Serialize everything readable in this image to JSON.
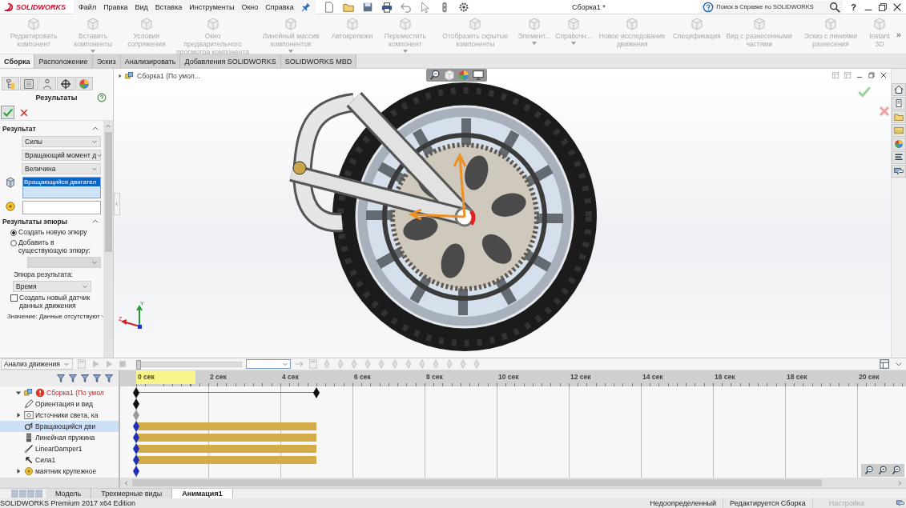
{
  "titlebar": {
    "logo": "SOLIDWORKS",
    "menu": [
      "Файл",
      "Правка",
      "Вид",
      "Вставка",
      "Инструменты",
      "Окно",
      "Справка"
    ],
    "title": "Сборка1 *",
    "search": {
      "placeholder": "Поиск в Справке по SOLIDWORKS"
    },
    "help": "?"
  },
  "ribbon": [
    {
      "label": "Редактировать компонент",
      "disabled": true,
      "has_menu": false
    },
    {
      "label": "Вставить компоненты",
      "disabled": true,
      "has_menu": true
    },
    {
      "label": "Условия сопряжения",
      "disabled": true,
      "has_menu": false
    },
    {
      "label": "Окно предварительного просмотра компонента",
      "disabled": true,
      "has_menu": false
    },
    {
      "label": "Линейный массив компонентов",
      "disabled": true,
      "has_menu": true
    },
    {
      "label": "Автокрепежи",
      "disabled": true,
      "has_menu": false
    },
    {
      "label": "Переместить компонент",
      "disabled": true,
      "has_menu": true
    },
    {
      "label": "Отобразить скрытые компоненты",
      "disabled": true,
      "has_menu": false
    },
    {
      "label": "Элемент...",
      "disabled": true,
      "has_menu": true
    },
    {
      "label": "Справочн...",
      "disabled": true,
      "has_menu": true
    },
    {
      "label": "Новое исследование движения",
      "disabled": true,
      "has_menu": false
    },
    {
      "label": "Спецификация",
      "disabled": true,
      "has_menu": false
    },
    {
      "label": "Вид с разнесенными частями",
      "disabled": true,
      "has_menu": false
    },
    {
      "label": "Эскиз с линиями разнесения",
      "disabled": true,
      "has_menu": false
    },
    {
      "label": "Instant 3D",
      "disabled": true,
      "has_menu": false
    }
  ],
  "ribbon_more": "»",
  "tabs": [
    {
      "label": "Сборка",
      "selected": true
    },
    {
      "label": "Расположение",
      "selected": false
    },
    {
      "label": "Эскиз",
      "selected": false
    },
    {
      "label": "Анализировать",
      "selected": false
    },
    {
      "label": "Добавления SOLIDWORKS",
      "selected": false
    },
    {
      "label": "SOLIDWORKS MBD",
      "selected": false
    }
  ],
  "property_manager": {
    "title": "Результаты",
    "result_section": "Результат",
    "dropdowns": [
      "Силы",
      "Вращающий момент д",
      "Величина"
    ],
    "selection": "Вращающийся двигател",
    "plot_section": "Результаты эпюры",
    "radios": [
      {
        "label": "Создать новую эпюру",
        "selected": true
      },
      {
        "label": "Добавить в существующую эпюру:",
        "selected": false
      }
    ],
    "plot_label": "Эпюра результата:",
    "plot_value": "Время",
    "checkbox": {
      "label": "Создать новый датчик данных движения",
      "checked": false
    },
    "value": "Значение: Данные отсутствуют"
  },
  "viewport": {
    "tree_root": "Сборка1  (По умол...",
    "triad": {
      "up": "Y",
      "left": "Z"
    }
  },
  "motion": {
    "study": "Анализ движения",
    "playback": {
      "level": 0
    },
    "ruler": [
      "0 сек",
      "2 сек",
      "4 сек",
      "6 сек",
      "8 сек",
      "10 сек",
      "12 сек",
      "14 сек",
      "16 сек",
      "18 сек",
      "20 сек"
    ],
    "tree": [
      {
        "label": "Сборка1  (По умол",
        "kind": "assembly",
        "error": true,
        "expanded": true,
        "selected": false,
        "track": {
          "kind": "span"
        }
      },
      {
        "label": "Ориентация и вид",
        "kind": "view",
        "error": false,
        "selected": false,
        "track": {
          "kind": "key"
        }
      },
      {
        "label": "Источники света, ка",
        "kind": "lights",
        "error": false,
        "expanded": false,
        "selected": false,
        "track": {
          "kind": "key-grey"
        }
      },
      {
        "label": "Вращающийся дви",
        "kind": "motor",
        "error": false,
        "selected": true,
        "track": {
          "kind": "bar"
        }
      },
      {
        "label": "Линейная пружина",
        "kind": "spring",
        "error": false,
        "selected": false,
        "track": {
          "kind": "bar"
        }
      },
      {
        "label": "LinearDamper1",
        "kind": "damper",
        "error": false,
        "selected": false,
        "track": {
          "kind": "bar"
        }
      },
      {
        "label": "Сила1",
        "kind": "force",
        "error": false,
        "selected": false,
        "track": {
          "kind": "bar"
        }
      },
      {
        "label": "маятник крупежное",
        "kind": "part",
        "error": false,
        "expanded": false,
        "selected": false,
        "track": {
          "kind": "key-blue"
        }
      }
    ]
  },
  "bottom_tabs": [
    {
      "label": "Модель",
      "selected": false
    },
    {
      "label": "Трехмерные виды",
      "selected": false
    },
    {
      "label": "Анимация1",
      "selected": true
    }
  ],
  "status": {
    "edition": "SOLIDWORKS Premium 2017 x64 Edition",
    "state": "Недоопределенный",
    "mode": "Редактируется Сборка",
    "custom": "Настройка"
  }
}
